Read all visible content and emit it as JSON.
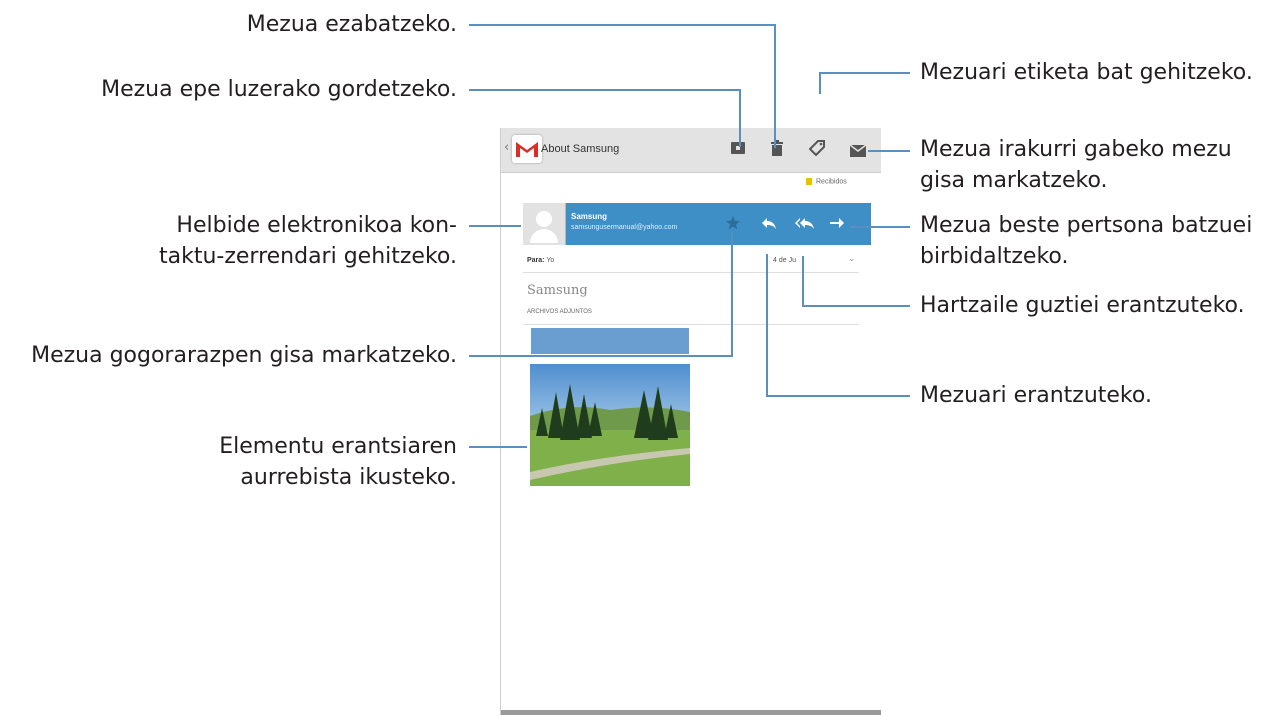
{
  "callouts": {
    "delete": "Mezua ezabatzeko.",
    "archive": "Mezua epe luzerako gordetzeko.",
    "label": "Mezuari etiketa bat gehitzeko.",
    "unread_1": "Mezua irakurri gabeko mezu",
    "unread_2": "gisa markatzeko.",
    "contact_1": "Helbide elektronikoa kon-",
    "contact_2": "taktu-zerrendari gehitzeko.",
    "forward_1": "Mezua beste pertsona batzuei",
    "forward_2": "birbidaltzeko.",
    "reply_all": "Hartzaile guztiei erantzuteko.",
    "star": "Mezua gogorarazpen gisa markatzeko.",
    "reply": "Mezuari erantzuteko.",
    "preview_1": "Elementu erantsiaren",
    "preview_2": "aurrebista ikusteko."
  },
  "app": {
    "title": "About Samsung",
    "folder": "Recibidos",
    "sender_name": "Samsung",
    "sender_email": "samsungusermanual@yahoo.com",
    "to_label": "Para:",
    "to_value": "Yo",
    "date": "4 de Ju",
    "subject": "Samsung",
    "attachments_label": "ARCHIVOS ADJUNTOS"
  },
  "icons": {
    "app": "gmail-icon",
    "archive": "archive-icon",
    "delete": "trash-icon",
    "label": "tag-icon",
    "unread": "envelope-icon",
    "star": "star-icon",
    "reply": "reply-icon",
    "reply_all": "reply-all-icon",
    "forward": "forward-icon"
  },
  "colors": {
    "accent": "#3d8fc5",
    "leader": "#5a8fbf"
  }
}
